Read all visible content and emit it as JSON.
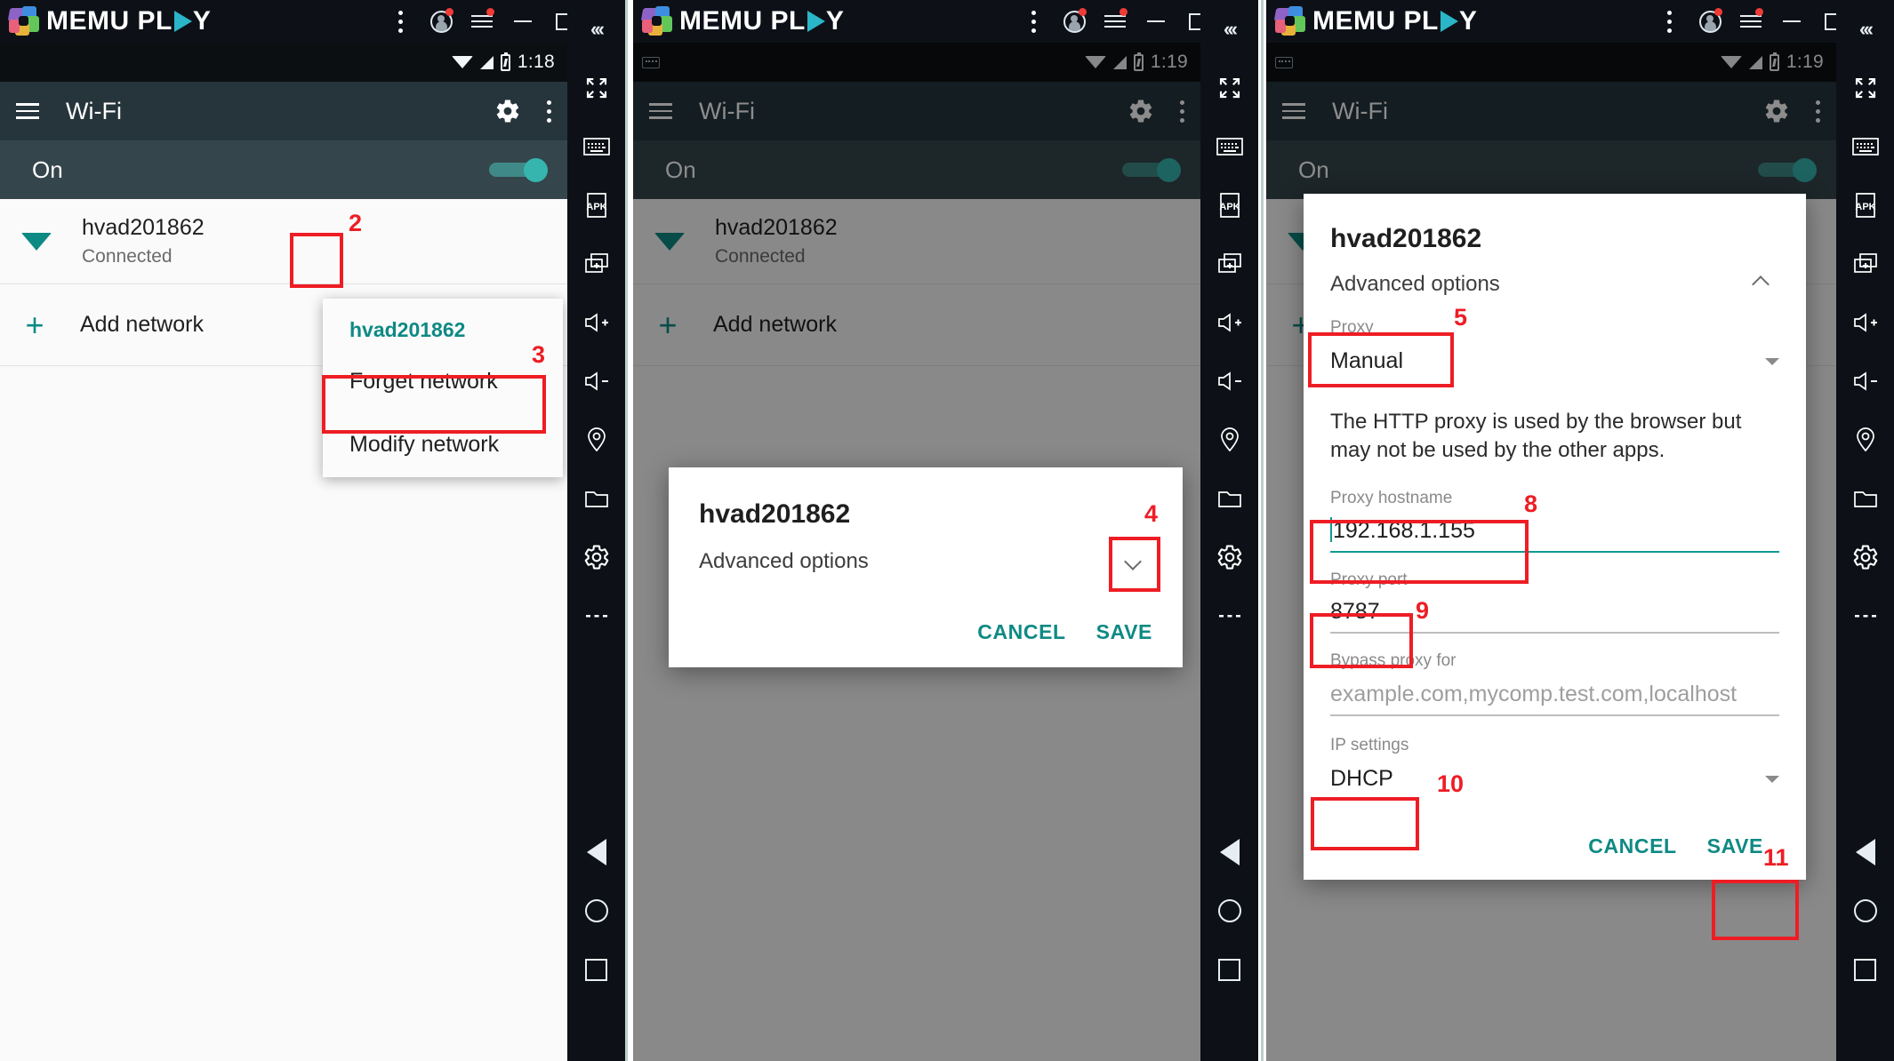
{
  "app": {
    "name": "MEMU PLAY",
    "logo_icon": "memu-pentagon-logo",
    "titlebar_buttons": [
      {
        "name": "kebab-menu",
        "icon": "kebab-icon"
      },
      {
        "name": "account",
        "icon": "account-icon",
        "badge": true
      },
      {
        "name": "menu",
        "icon": "hamburger-icon",
        "badge": true
      },
      {
        "name": "minimize",
        "icon": "minimize-icon"
      },
      {
        "name": "maximize",
        "icon": "maximize-icon"
      },
      {
        "name": "close",
        "icon": "close-icon"
      }
    ]
  },
  "rail": {
    "items": [
      {
        "name": "collapse",
        "icon": "chevrons-left-icon",
        "glyph": "«‹"
      },
      {
        "name": "fullscreen",
        "icon": "fullscreen-icon"
      },
      {
        "name": "keyboard",
        "icon": "keyboard-icon"
      },
      {
        "name": "apk-install",
        "icon": "apk-icon",
        "glyph": "APK"
      },
      {
        "name": "multi-window",
        "icon": "add-window-icon"
      },
      {
        "name": "volume-up",
        "icon": "volume-up-icon"
      },
      {
        "name": "volume-down",
        "icon": "volume-down-icon"
      },
      {
        "name": "location",
        "icon": "location-pin-icon"
      },
      {
        "name": "shared-folder",
        "icon": "folder-icon"
      },
      {
        "name": "settings",
        "icon": "gear-icon"
      },
      {
        "name": "more",
        "icon": "more-dots-icon"
      }
    ],
    "nav": [
      {
        "name": "back",
        "icon": "back-triangle-icon"
      },
      {
        "name": "home",
        "icon": "home-circle-icon"
      },
      {
        "name": "recents",
        "icon": "recents-square-icon"
      }
    ]
  },
  "panels": [
    {
      "id": "panel-1",
      "status_bar": {
        "time": "1:18",
        "icons": [
          "wifi-icon",
          "signal-icon",
          "battery-icon"
        ],
        "keyboard_icon": false
      },
      "appbar": {
        "title": "Wi-Fi",
        "menu_icon": "hamburger-icon",
        "gear_icon": "gear-icon",
        "kebab_icon": "kebab-icon"
      },
      "toggle_row": {
        "label": "On",
        "state": "on"
      },
      "networks": [
        {
          "name": "hvad201862",
          "status": "Connected",
          "icon": "wifi-signal-icon"
        }
      ],
      "add_network": {
        "label": "Add network",
        "icon": "plus-icon"
      },
      "popup_menu": {
        "header": "hvad201862",
        "items": [
          "Forget network",
          "Modify network"
        ]
      },
      "annotations": [
        {
          "num": "2",
          "target": "network-row-tap-point"
        },
        {
          "num": "3",
          "target": "modify-network-item"
        }
      ]
    },
    {
      "id": "panel-2",
      "status_bar": {
        "time": "1:19",
        "icons": [
          "wifi-icon",
          "signal-icon",
          "battery-icon"
        ],
        "keyboard_icon": true
      },
      "appbar": {
        "title": "Wi-Fi",
        "menu_icon": "hamburger-icon",
        "gear_icon": "gear-icon",
        "kebab_icon": "kebab-icon"
      },
      "toggle_row": {
        "label": "On",
        "state": "on"
      },
      "networks": [
        {
          "name": "hvad201862",
          "status": "Connected",
          "icon": "wifi-signal-icon"
        }
      ],
      "add_network": {
        "label": "Add network",
        "icon": "plus-icon"
      },
      "dialog": {
        "title": "hvad201862",
        "advanced_label": "Advanced options",
        "expander_icon": "chevron-down-icon",
        "cancel_label": "CANCEL",
        "save_label": "SAVE"
      },
      "annotations": [
        {
          "num": "4",
          "target": "advanced-options-expander"
        }
      ]
    },
    {
      "id": "panel-3",
      "status_bar": {
        "time": "1:19",
        "icons": [
          "wifi-icon",
          "signal-icon",
          "battery-icon"
        ],
        "keyboard_icon": true
      },
      "appbar": {
        "title": "Wi-Fi",
        "menu_icon": "hamburger-icon",
        "gear_icon": "gear-icon",
        "kebab_icon": "kebab-icon"
      },
      "toggle_row": {
        "label": "On",
        "state": "on"
      },
      "networks": [
        {
          "name": "hvad201862",
          "status": "Connected",
          "icon": "wifi-signal-icon"
        }
      ],
      "dialog": {
        "title": "hvad201862",
        "advanced_label": "Advanced options",
        "expander_icon": "chevron-up-icon",
        "proxy_label": "Proxy",
        "proxy_value": "Manual",
        "proxy_description": "The HTTP proxy is used by the browser but may not be used by the other apps.",
        "hostname_label": "Proxy hostname",
        "hostname_value": "192.168.1.155",
        "port_label": "Proxy port",
        "port_value": "8787",
        "bypass_label": "Bypass proxy for",
        "bypass_placeholder": "example.com,mycomp.test.com,localhost",
        "ip_settings_label": "IP settings",
        "ip_settings_value": "DHCP",
        "cancel_label": "CANCEL",
        "save_label": "SAVE"
      },
      "annotations": [
        {
          "num": "5",
          "target": "proxy-select"
        },
        {
          "num": "8",
          "target": "proxy-hostname-input"
        },
        {
          "num": "9",
          "target": "proxy-port-input"
        },
        {
          "num": "10",
          "target": "ip-settings-select"
        },
        {
          "num": "11",
          "target": "save-button"
        }
      ]
    }
  ],
  "colors": {
    "accent_teal": "#0e8a84",
    "annotation_red": "#ee1d24",
    "appbar": "#26353c",
    "chrome_dark": "#0d1117"
  }
}
